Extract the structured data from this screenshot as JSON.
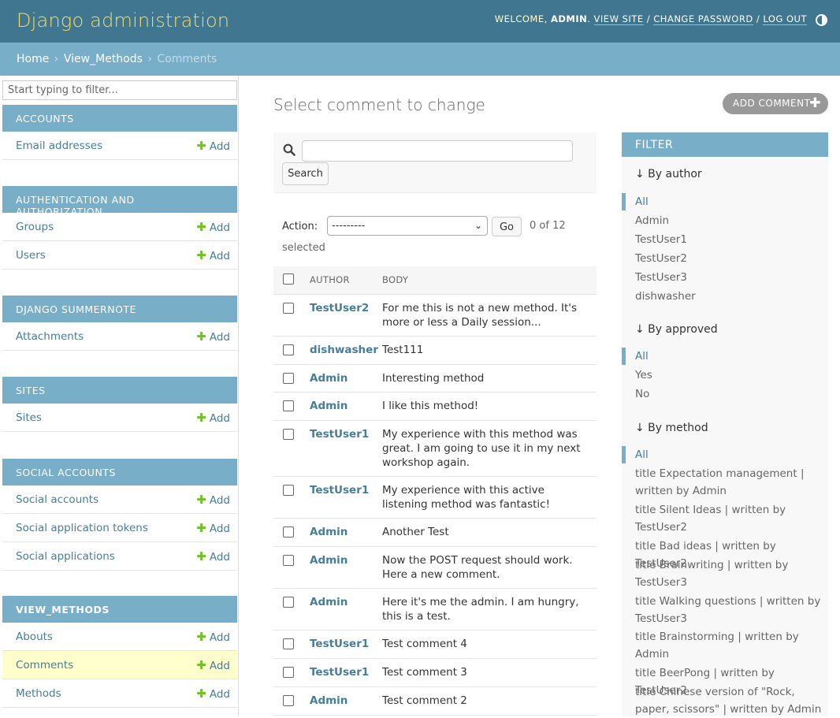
{
  "header": {
    "brand": "Django administration",
    "welcome": "WELCOME,",
    "user": "ADMIN",
    "view_site": "VIEW SITE",
    "change_password": "CHANGE PASSWORD",
    "logout": "LOG OUT"
  },
  "breadcrumbs": {
    "home": "Home",
    "app": "View_Methods",
    "current": "Comments"
  },
  "sidebar": {
    "filter_placeholder": "Start typing to filter...",
    "add_label": "Add",
    "modules": [
      {
        "caption": "ACCOUNTS",
        "models": [
          "Email addresses"
        ]
      },
      {
        "caption": "AUTHENTICATION AND AUTHORIZATION",
        "models": [
          "Groups",
          "Users"
        ]
      },
      {
        "caption": "DJANGO SUMMERNOTE",
        "models": [
          "Attachments"
        ]
      },
      {
        "caption": "SITES",
        "models": [
          "Sites"
        ]
      },
      {
        "caption": "SOCIAL ACCOUNTS",
        "models": [
          "Social accounts",
          "Social application tokens",
          "Social applications"
        ]
      },
      {
        "caption": "VIEW_METHODS",
        "models": [
          "Abouts",
          "Comments",
          "Methods"
        ]
      }
    ]
  },
  "main": {
    "title": "Select comment to change",
    "add_button": "ADD COMMENT",
    "search_button": "Search",
    "action_label": "Action:",
    "action_value": "---------",
    "go_button": "Go",
    "counter": "0 of 12",
    "counter_suffix": "selected",
    "columns": [
      "AUTHOR",
      "BODY"
    ],
    "rows": [
      {
        "author": "TestUser2",
        "body": "For me this is not a new method. It's more or less a Daily session..."
      },
      {
        "author": "dishwasher",
        "body": "Test111"
      },
      {
        "author": "Admin",
        "body": "Interesting method"
      },
      {
        "author": "Admin",
        "body": "I like this method!"
      },
      {
        "author": "TestUser1",
        "body": "My experience with this method was great. I am going to use it in my next workshop again."
      },
      {
        "author": "TestUser1",
        "body": "My experience with this active listening method was fantastic!"
      },
      {
        "author": "Admin",
        "body": "Another Test"
      },
      {
        "author": "Admin",
        "body": "Now the POST request should work. Here a new comment."
      },
      {
        "author": "Admin",
        "body": "Here it's me the admin. I am hungry, this is a test."
      },
      {
        "author": "TestUser1",
        "body": "Test comment 4"
      },
      {
        "author": "TestUser1",
        "body": "Test comment 3"
      },
      {
        "author": "Admin",
        "body": "Test comment 2"
      }
    ]
  },
  "filter": {
    "title": "FILTER",
    "groups": [
      {
        "title": "↓ By author",
        "options": [
          "All",
          "Admin",
          "TestUser1",
          "TestUser2",
          "TestUser3",
          "dishwasher"
        ]
      },
      {
        "title": "↓ By approved",
        "options": [
          "All",
          "Yes",
          "No"
        ]
      },
      {
        "title": "↓ By method",
        "options": [
          "All",
          "title Expectation management | written by Admin",
          "title Silent Ideas | written by TestUser2",
          "title Bad ideas | written by TestUser2",
          "title Brainwriting | written by TestUser3",
          "title Walking questions | written by TestUser3",
          "title Brainstorming | written by Admin",
          "title BeerPong | written by TestUser2",
          "title Chinese version of \"Rock, paper, scissors\" | written by Admin"
        ]
      }
    ]
  },
  "colors": {
    "header": "#417690",
    "brand": "#f5dd5d",
    "accent": "#79aec8",
    "link": "#447e9b",
    "add_plus": "#70bf2b",
    "active_row": "#ffffcc"
  }
}
